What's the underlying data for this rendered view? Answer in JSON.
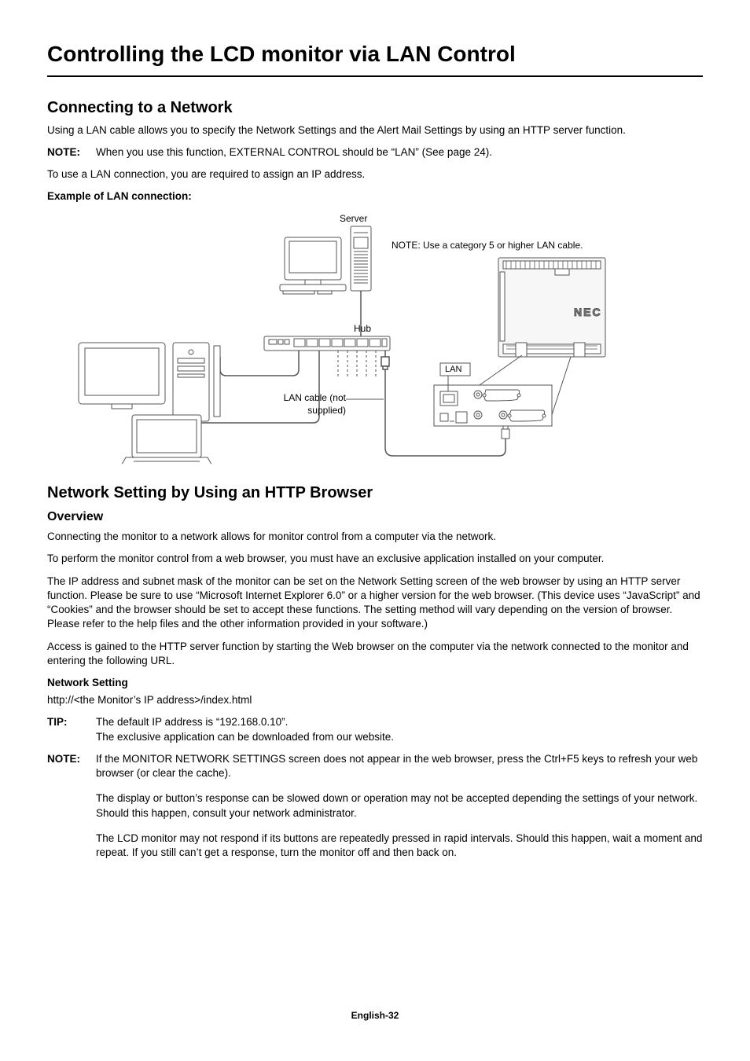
{
  "title": "Controlling the LCD monitor via LAN Control",
  "h2_connecting": "Connecting to a Network",
  "p_intro": "Using a LAN cable allows you to specify the Network Settings and the Alert Mail Settings by using an HTTP server function.",
  "note1_label": "NOTE:",
  "note1_body": "When you use this function, EXTERNAL CONTROL should be “LAN” (See page 24).",
  "p_assign": "To use a LAN connection, you are required to assign an IP address.",
  "example_label": "Example of LAN connection:",
  "diagram": {
    "server": "Server",
    "hub": "Hub",
    "lan_cable": "LAN cable (not supplied)",
    "note_cat5": "NOTE: Use a category 5 or higher LAN cable.",
    "lan": "LAN"
  },
  "h2_network": "Network Setting by Using an HTTP Browser",
  "h3_overview": "Overview",
  "p_ov1": "Connecting the monitor to a network allows for monitor control from a computer via the network.",
  "p_ov2": "To perform the monitor control from a web browser, you must have an exclusive application installed on your computer.",
  "p_ov3": "The IP address and subnet mask of the monitor can be set on the Network Setting screen of the web browser by using an HTTP server function. Please be sure to use “Microsoft Internet Explorer 6.0” or a higher version for the web browser. (This device uses “JavaScript” and “Cookies” and the browser should be set to accept these functions. The setting method will vary depending on the version of browser. Please refer to the help files and the other information provided in your software.)",
  "p_ov4": "Access is gained to the HTTP server function by starting the Web browser on the computer via the network connected to the monitor and entering the following URL.",
  "ns_label": "Network Setting",
  "ns_url": "http://<the Monitor’s IP address>/index.html",
  "tip_label": "TIP:",
  "tip_body1": "The default IP address is “192.168.0.10”.",
  "tip_body2": "The exclusive application can be downloaded from our website.",
  "note2_label": "NOTE:",
  "note2_p1": "If the MONITOR NETWORK SETTINGS screen does not appear in the web browser, press the Ctrl+F5 keys to refresh your web browser (or clear the cache).",
  "note2_p2": "The display or button’s response can be slowed down or operation may not be accepted depending the settings of your network. Should this happen, consult your network administrator.",
  "note2_p3": "The LCD monitor may not respond if its buttons are repeatedly pressed in rapid intervals. Should this happen, wait a moment and repeat. If you still can’t get a response, turn the monitor off and then back on.",
  "footer": "English-32"
}
